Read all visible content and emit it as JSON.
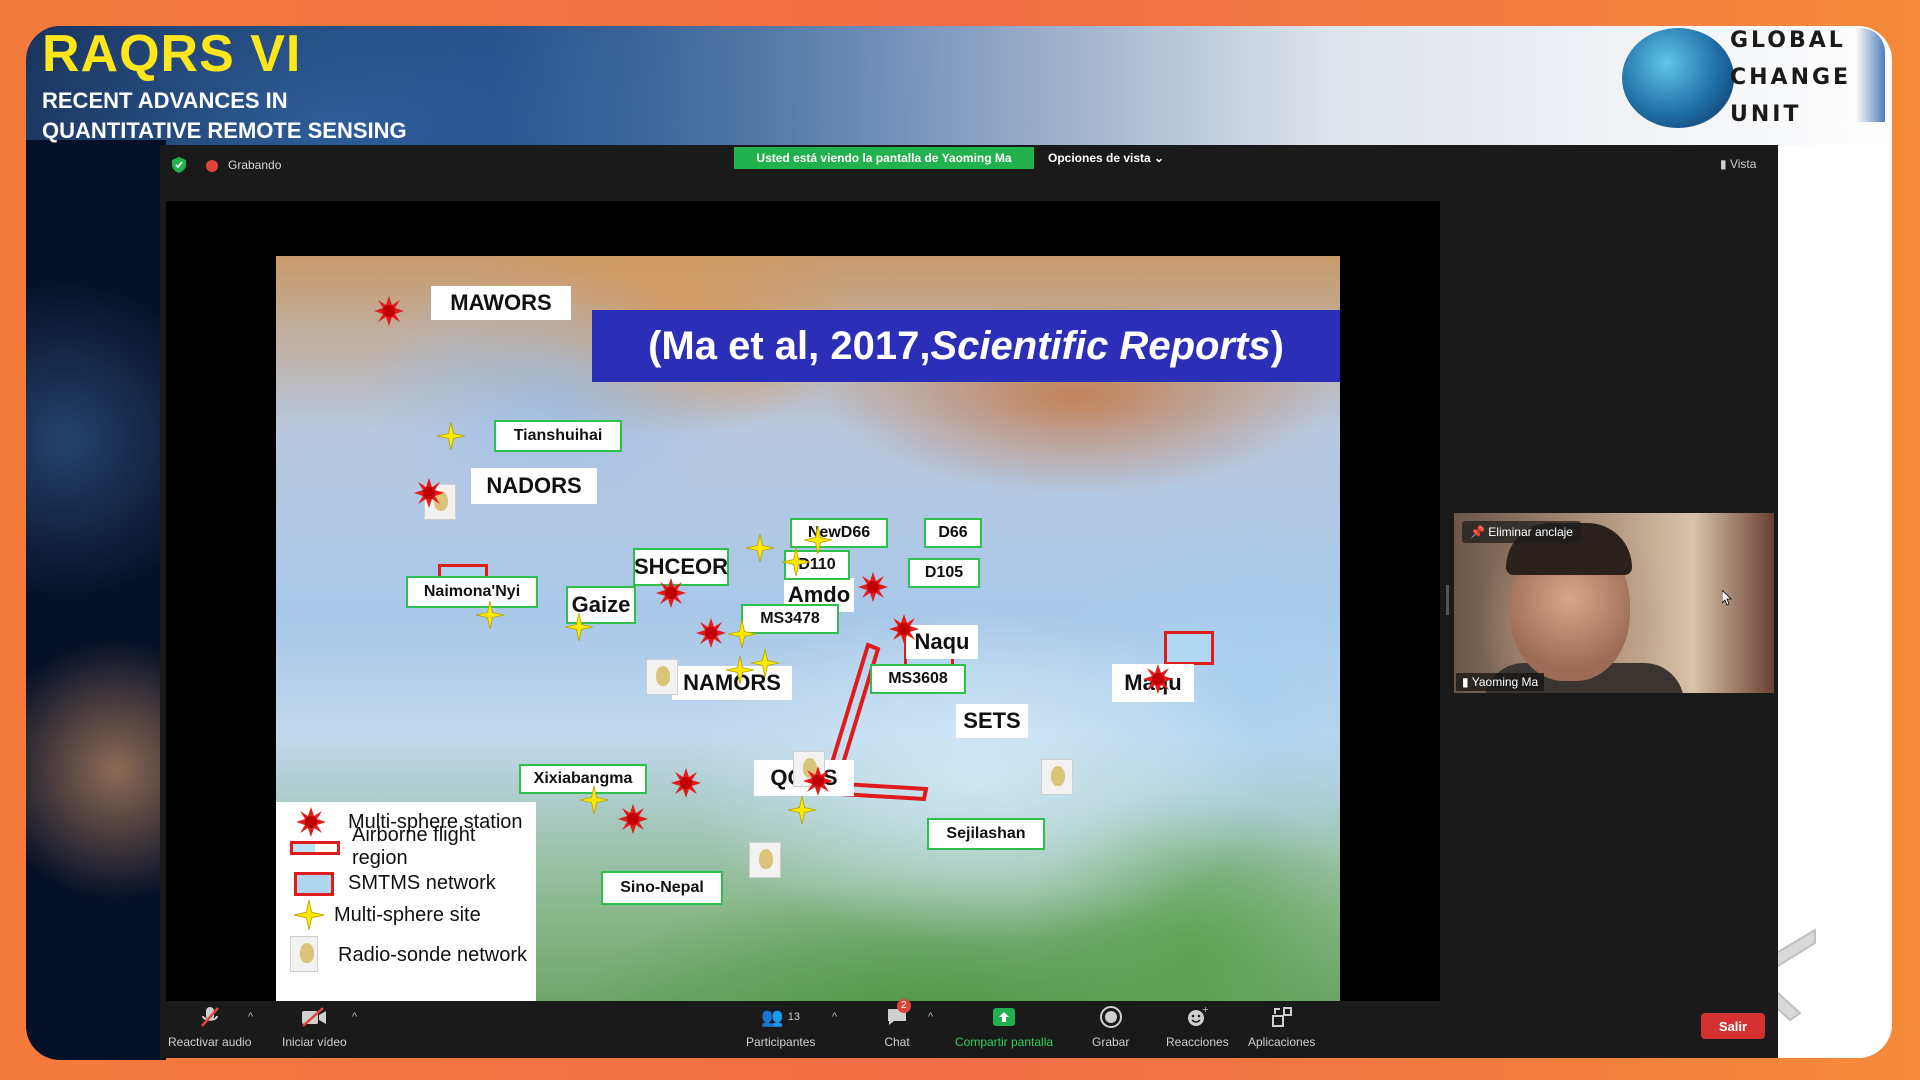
{
  "conference": {
    "title": "RAQRS VI",
    "subtitle_line1": "RECENT ADVANCES IN",
    "subtitle_line2": "QUANTITATIVE REMOTE SENSING",
    "logo_lines": [
      "GLOBAL",
      "CHANGE",
      "UNIT"
    ]
  },
  "zoom": {
    "recording_label": "Grabando",
    "share_banner": "Usted está viendo la pantalla de Yaoming Ma",
    "view_options": "Opciones de vista ⌄",
    "vista_label": "Vista",
    "unpin_label": "Eliminar anclaje",
    "participant_name": "Yaoming Ma",
    "toolbar": {
      "audio": "Reactivar audio",
      "video": "Iniciar vídeo",
      "participants": "Participantes",
      "participant_count": "13",
      "chat": "Chat",
      "chat_badge": "2",
      "share": "Compartir pantalla",
      "record": "Grabar",
      "reactions": "Reacciones",
      "apps": "Aplicaciones",
      "exit": "Salir"
    }
  },
  "slide": {
    "citation_main": "(Ma et al, 2017,",
    "citation_italic": "Scientific Reports",
    "citation_close": ")",
    "sites": {
      "mawors": "MAWORS",
      "tianshuihai": "Tianshuihai",
      "nadors": "NADORS",
      "naimona": "Naimona'Nyi",
      "gaize": "Gaize",
      "shceor": "SHCEOR",
      "amdo": "Amdo",
      "newd66": "NewD66",
      "d66": "D66",
      "d110": "D110",
      "d105": "D105",
      "ms3478": "MS3478",
      "naqu": "Naqu",
      "namors": "NAMORS",
      "ms3608": "MS3608",
      "maqu": "Maqu",
      "xixiabangma": "Xixiabangma",
      "sets": "SETS",
      "qoms": "QOMS",
      "sejilashan": "Sejilashan",
      "sino_nepal": "Sino-Nepal"
    },
    "legend": [
      {
        "symbol": "red-star-icon",
        "label": "Multi-sphere station"
      },
      {
        "symbol": "flight-region-icon",
        "label": "Airborne flight region"
      },
      {
        "symbol": "smtms-box-icon",
        "label": "SMTMS network"
      },
      {
        "symbol": "yellow-star-icon",
        "label": "Multi-sphere site"
      },
      {
        "symbol": "radiosonde-icon",
        "label": "Radio-sonde network"
      }
    ]
  },
  "colors": {
    "accent_green": "#23b14d",
    "exit_red": "#d63131",
    "citation_blue": "#2b2fb8",
    "title_yellow": "#ffe61a"
  }
}
